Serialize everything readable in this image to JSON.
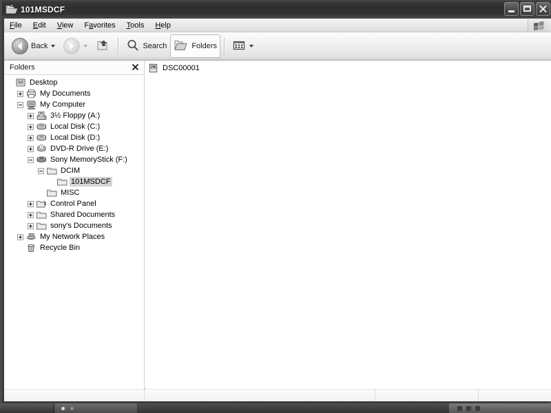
{
  "window": {
    "title": "101MSDCF",
    "title_icon": "open-folder-icon",
    "controls": {
      "minimize": "Minimize",
      "maximize": "Maximize",
      "close": "Close"
    }
  },
  "menubar": {
    "items": [
      {
        "label": "File",
        "accel": "F"
      },
      {
        "label": "Edit",
        "accel": "E"
      },
      {
        "label": "View",
        "accel": "V"
      },
      {
        "label": "Favorites",
        "accel": "a"
      },
      {
        "label": "Tools",
        "accel": "T"
      },
      {
        "label": "Help",
        "accel": "H"
      }
    ],
    "logo_icon": "windows-flag-icon"
  },
  "toolbar": {
    "back": {
      "label": "Back",
      "icon": "back-arrow-icon",
      "enabled": true,
      "has_dropdown": true
    },
    "forward": {
      "label": "",
      "icon": "forward-arrow-icon",
      "enabled": false,
      "has_dropdown": true
    },
    "up": {
      "label": "",
      "icon": "up-folder-icon",
      "enabled": true
    },
    "search": {
      "label": "Search",
      "icon": "magnifier-icon"
    },
    "folders": {
      "label": "Folders",
      "icon": "folders-icon",
      "pressed": true
    },
    "views": {
      "label": "",
      "icon": "views-icon",
      "has_dropdown": true
    }
  },
  "folder_pane": {
    "title": "Folders",
    "close_icon": "close-icon",
    "tree": [
      {
        "label": "Desktop",
        "indent": 0,
        "expander": "none",
        "icon": "desktop-icon",
        "selected": false
      },
      {
        "label": "My Documents",
        "indent": 1,
        "expander": "plus",
        "icon": "my-documents-icon",
        "selected": false
      },
      {
        "label": "My Computer",
        "indent": 1,
        "expander": "minus",
        "icon": "my-computer-icon",
        "selected": false
      },
      {
        "label": "3½ Floppy (A:)",
        "indent": 2,
        "expander": "plus",
        "icon": "floppy-drive-icon",
        "selected": false
      },
      {
        "label": "Local Disk (C:)",
        "indent": 2,
        "expander": "plus",
        "icon": "hard-drive-icon",
        "selected": false
      },
      {
        "label": "Local Disk (D:)",
        "indent": 2,
        "expander": "plus",
        "icon": "hard-drive-icon",
        "selected": false
      },
      {
        "label": "DVD-R Drive (E:)",
        "indent": 2,
        "expander": "plus",
        "icon": "optical-drive-icon",
        "selected": false
      },
      {
        "label": "Sony MemoryStick (F:)",
        "indent": 2,
        "expander": "minus",
        "icon": "removable-drive-icon",
        "selected": false
      },
      {
        "label": "DCIM",
        "indent": 3,
        "expander": "minus",
        "icon": "folder-icon",
        "selected": false
      },
      {
        "label": "101MSDCF",
        "indent": 4,
        "expander": "none",
        "icon": "folder-icon",
        "selected": true
      },
      {
        "label": "MISC",
        "indent": 3,
        "expander": "none",
        "icon": "folder-icon",
        "selected": false
      },
      {
        "label": "Control Panel",
        "indent": 2,
        "expander": "plus",
        "icon": "control-panel-icon",
        "selected": false
      },
      {
        "label": "Shared Documents",
        "indent": 2,
        "expander": "plus",
        "icon": "folder-icon",
        "selected": false
      },
      {
        "label": "sony's Documents",
        "indent": 2,
        "expander": "plus",
        "icon": "folder-icon",
        "selected": false
      },
      {
        "label": "My Network Places",
        "indent": 1,
        "expander": "plus",
        "icon": "network-icon",
        "selected": false
      },
      {
        "label": "Recycle Bin",
        "indent": 1,
        "expander": "none",
        "icon": "recycle-bin-icon",
        "selected": false
      }
    ]
  },
  "file_list": {
    "items": [
      {
        "label": "DSC00001",
        "icon": "image-file-icon",
        "selected": false
      }
    ]
  },
  "status_bar": {
    "panes": [
      "",
      "",
      "",
      ""
    ]
  },
  "taskbar": {
    "start_label": "",
    "quick_launch": [
      "ql-icon-1",
      "ql-icon-2"
    ],
    "tray_icons": [
      "tray-icon-1",
      "tray-icon-2",
      "tray-icon-3"
    ]
  },
  "colors": {
    "titlebar": "#2e2e2e",
    "selection": "#d6d4d6",
    "toolbar_bg": "#f0f0f0",
    "client_bg": "#ffffff",
    "taskbar": "#3f3f3f"
  }
}
